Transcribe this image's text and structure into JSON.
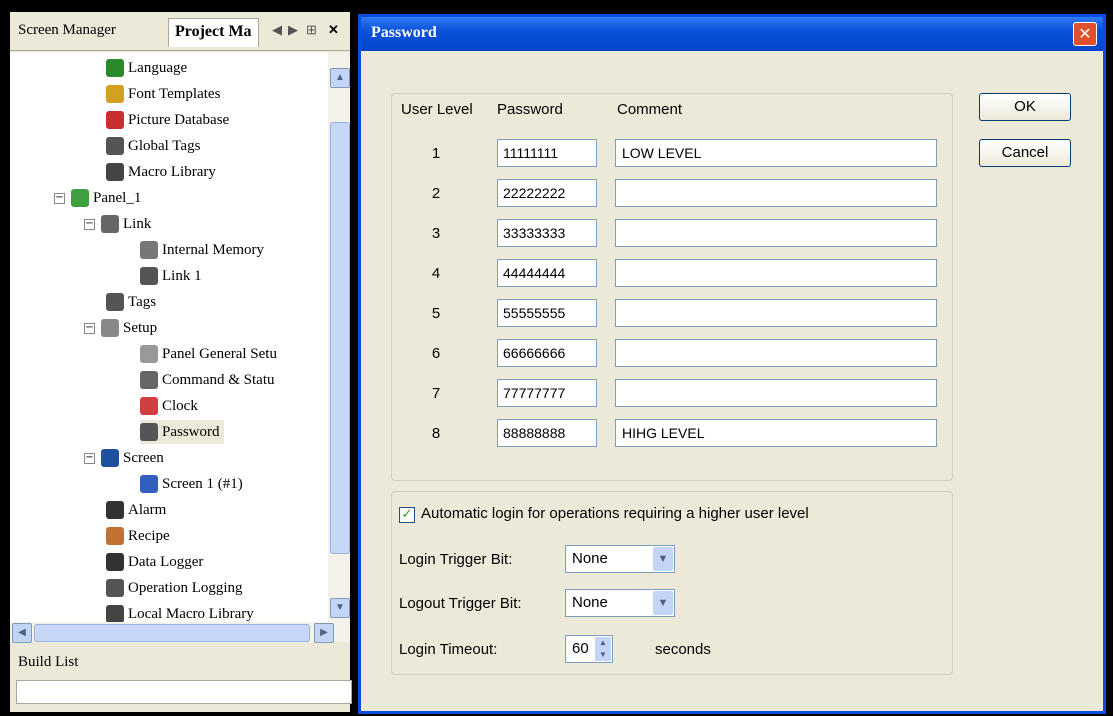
{
  "left_panel": {
    "tab_screen_manager": "Screen Manager",
    "tab_project_manager": "Project Ma",
    "tab_controls": [
      "◀",
      "▶",
      "⊞",
      "✕"
    ],
    "tree": [
      {
        "label": "Language",
        "icon": "globe-icon",
        "color": "#2a8a2a"
      },
      {
        "label": "Font Templates",
        "icon": "font-templates-icon",
        "color": "#d4a020"
      },
      {
        "label": "Picture Database",
        "icon": "picture-database-icon",
        "color": "#c83030"
      },
      {
        "label": "Global Tags",
        "icon": "tags-icon",
        "color": "#555555"
      },
      {
        "label": "Macro Library",
        "icon": "macro-library-icon",
        "color": "#444444"
      },
      {
        "label": "Panel_1",
        "icon": "panel-icon",
        "color": "#40a040"
      },
      {
        "label": "Link",
        "icon": "link-icon",
        "color": "#666666"
      },
      {
        "label": "Internal Memory",
        "icon": "memory-icon",
        "color": "#777777"
      },
      {
        "label": "Link 1",
        "icon": "link1-icon",
        "color": "#555555"
      },
      {
        "label": "Tags",
        "icon": "tags-icon",
        "color": "#555555"
      },
      {
        "label": "Setup",
        "icon": "wrench-icon",
        "color": "#888888"
      },
      {
        "label": "Panel General Setu",
        "icon": "panel-general-icon",
        "color": "#999999"
      },
      {
        "label": "Command & Statu",
        "icon": "command-icon",
        "color": "#666666"
      },
      {
        "label": "Clock",
        "icon": "clock-icon",
        "color": "#d04040"
      },
      {
        "label": "Password",
        "icon": "password-icon",
        "color": "#555555"
      },
      {
        "label": "Screen",
        "icon": "screen-icon",
        "color": "#2050a0"
      },
      {
        "label": "Screen 1 (#1)",
        "icon": "screen-page-icon",
        "color": "#3060c0"
      },
      {
        "label": "Alarm",
        "icon": "alarm-icon",
        "color": "#333333"
      },
      {
        "label": "Recipe",
        "icon": "recipe-icon",
        "color": "#c07030"
      },
      {
        "label": "Data Logger",
        "icon": "data-logger-icon",
        "color": "#333333"
      },
      {
        "label": "Operation Logging",
        "icon": "operation-logging-icon",
        "color": "#555555"
      },
      {
        "label": "Local Macro Library",
        "icon": "local-macro-icon",
        "color": "#444444"
      }
    ],
    "build_list": "Build List"
  },
  "dialog": {
    "title": "Password",
    "close": "✕",
    "headers": {
      "user_level": "User Level",
      "password": "Password",
      "comment": "Comment"
    },
    "rows": [
      {
        "level": "1",
        "password": "11111111",
        "comment": "LOW LEVEL"
      },
      {
        "level": "2",
        "password": "22222222",
        "comment": ""
      },
      {
        "level": "3",
        "password": "33333333",
        "comment": ""
      },
      {
        "level": "4",
        "password": "44444444",
        "comment": ""
      },
      {
        "level": "5",
        "password": "55555555",
        "comment": ""
      },
      {
        "level": "6",
        "password": "66666666",
        "comment": ""
      },
      {
        "level": "7",
        "password": "77777777",
        "comment": ""
      },
      {
        "level": "8",
        "password": "88888888",
        "comment": "HIHG LEVEL"
      }
    ],
    "ok": "OK",
    "cancel": "Cancel",
    "auto_login_label": "Automatic login for operations requiring a higher user level",
    "auto_login_checked": "✓",
    "login_trigger_label": "Login Trigger Bit:",
    "login_trigger_value": "None",
    "logout_trigger_label": "Logout Trigger Bit:",
    "logout_trigger_value": "None",
    "timeout_label": "Login Timeout:",
    "timeout_value": "60",
    "timeout_unit": "seconds"
  }
}
